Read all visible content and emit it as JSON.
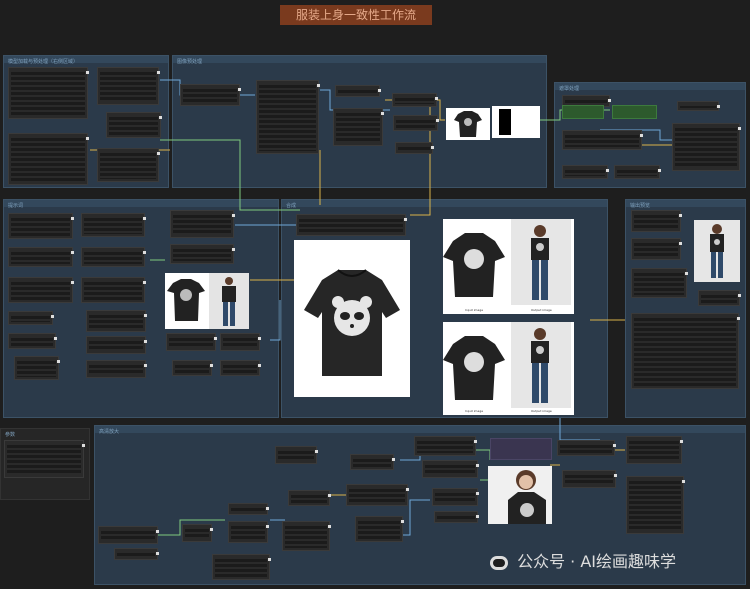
{
  "workflow": {
    "title": "服装上身一致性工作流"
  },
  "groups": {
    "load_models": "模型加载与预处理（右侧区域）",
    "preprocess": "图像预处理",
    "segment": "遮罩处理",
    "control": "提示词",
    "compose": "合成",
    "preview": "输出预览",
    "upscale": "高清放大",
    "side": "参数"
  },
  "previews": {
    "caption_input": "Input image",
    "caption_output": "Output image"
  },
  "watermark": {
    "text": "公众号 · AI绘画趣味学"
  },
  "colors": {
    "group_bg": "#2b3a4a",
    "node_bg": "#2a2a2a",
    "title_badge": "#7a3a1e",
    "wire_yellow": "#d8b34a",
    "wire_blue": "#6fa8d8",
    "wire_green": "#7fc97f"
  }
}
